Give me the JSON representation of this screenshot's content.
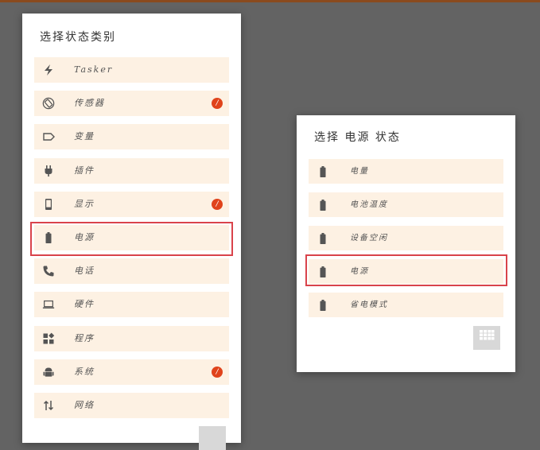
{
  "left_dialog": {
    "title": "选择状态类别",
    "items": [
      {
        "label": "Tasker",
        "icon": "lightning-icon"
      },
      {
        "label": "传感器",
        "icon": "rotation-icon",
        "badge": "/"
      },
      {
        "label": "变量",
        "icon": "tag-icon"
      },
      {
        "label": "插件",
        "icon": "plug-icon"
      },
      {
        "label": "显示",
        "icon": "phone-icon",
        "badge": "/"
      },
      {
        "label": "电源",
        "icon": "battery-icon"
      },
      {
        "label": "电话",
        "icon": "call-icon"
      },
      {
        "label": "硬件",
        "icon": "laptop-icon"
      },
      {
        "label": "程序",
        "icon": "apps-icon"
      },
      {
        "label": "系统",
        "icon": "android-icon",
        "badge": "/"
      },
      {
        "label": "网络",
        "icon": "transfer-arrows-icon"
      }
    ]
  },
  "right_dialog": {
    "title": "选择 电源 状态",
    "items": [
      {
        "label": "电量",
        "icon": "battery-icon"
      },
      {
        "label": "电池温度",
        "icon": "battery-icon"
      },
      {
        "label": "设备空闲",
        "icon": "battery-icon"
      },
      {
        "label": "电源",
        "icon": "battery-icon"
      },
      {
        "label": "省电模式",
        "icon": "battery-icon"
      }
    ]
  },
  "colors": {
    "background": "#636363",
    "item_bg": "#fdf1e3",
    "highlight": "#d9434b",
    "badge": "#e0431b"
  }
}
